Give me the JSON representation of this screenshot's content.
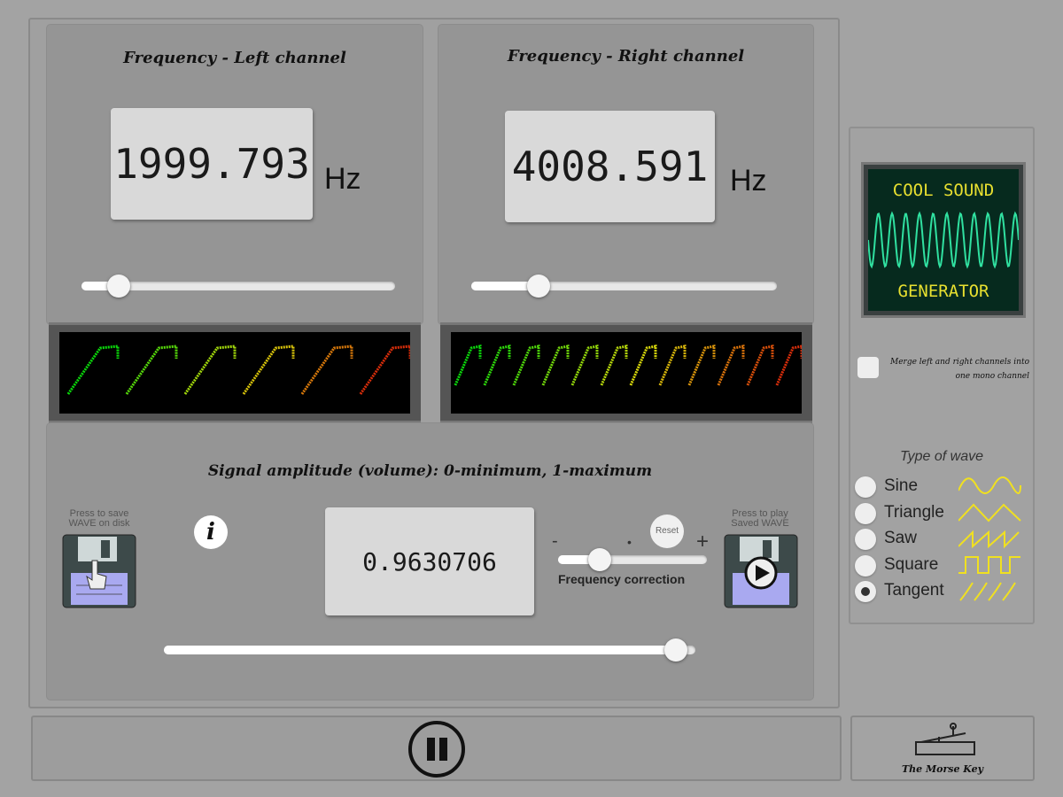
{
  "left": {
    "title": "Frequency - Left channel",
    "value": "1999.793",
    "unit": "Hz",
    "slider_fraction": 0.12,
    "meter_marks": 6
  },
  "right": {
    "title": "Frequency - Right channel",
    "value": "4008.591",
    "unit": "Hz",
    "slider_fraction": 0.22,
    "meter_marks": 12
  },
  "amplitude": {
    "title": "Signal amplitude (volume): 0-minimum, 1-maximum",
    "value": "0.9630706",
    "slider_fraction": 0.963
  },
  "save": {
    "label": "Press to save WAVE on disk"
  },
  "play": {
    "label": "Press to play Saved WAVE"
  },
  "info": {
    "icon": "i"
  },
  "correction": {
    "label": "Frequency correction",
    "minus": "-",
    "dot": "•",
    "plus": "+",
    "reset": "Reset",
    "slider_fraction": 0.28
  },
  "logo": {
    "line1": "COOL SOUND",
    "line2": "GENERATOR"
  },
  "merge": {
    "label": "Merge left and right channels into one mono channel",
    "checked": false
  },
  "wave": {
    "title": "Type of wave",
    "options": [
      "Sine",
      "Triangle",
      "Saw",
      "Square",
      "Tangent"
    ],
    "selected": "Tangent"
  },
  "morse": {
    "label": "The Morse Key"
  },
  "colors": {
    "wave": "#f0e020",
    "logo_text": "#e8e030",
    "logo_wave": "#30e0a0"
  }
}
